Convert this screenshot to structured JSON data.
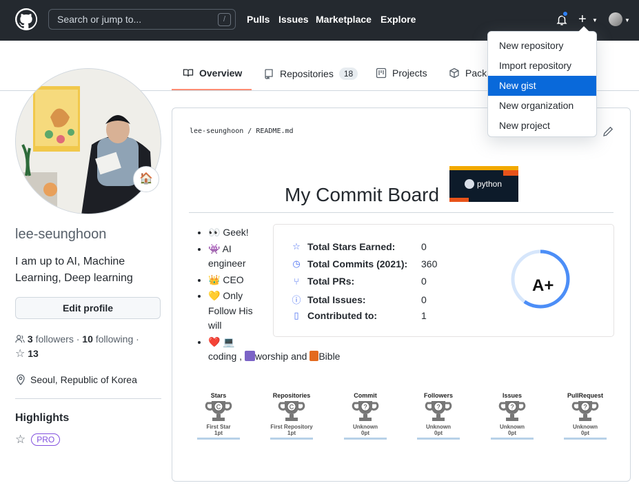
{
  "header": {
    "search_placeholder": "Search or jump to...",
    "search_shortcut": "/",
    "nav": [
      "Pulls",
      "Issues",
      "Marketplace",
      "Explore"
    ]
  },
  "dropdown": {
    "items": [
      "New repository",
      "Import repository",
      "New gist",
      "New organization",
      "New project"
    ],
    "active": "New gist"
  },
  "tabs": {
    "overview": "Overview",
    "repositories": "Repositories",
    "repositories_count": "18",
    "projects": "Projects",
    "packages": "Packa"
  },
  "profile": {
    "username": "lee-seunghoon",
    "bio": "I am up to AI, Machine Learning, Deep learning",
    "edit_button": "Edit profile",
    "followers_count": "3",
    "followers_label": "followers",
    "following_count": "10",
    "following_label": "following",
    "stars_count": "13",
    "location": "Seoul, Republic of Korea",
    "highlights_title": "Highlights",
    "pro_badge": "PRO"
  },
  "readme": {
    "path_owner": "lee-seunghoon",
    "path_file": "README.md",
    "title": "My Commit Board",
    "python_badge": "python",
    "list": [
      {
        "emoji": "👀",
        "text": "Geek!"
      },
      {
        "emoji": "👾",
        "text": "AI engineer"
      },
      {
        "emoji": "👑",
        "text": "CEO"
      },
      {
        "emoji": "💛",
        "text": "Only Follow His will"
      },
      {
        "emoji": "❤️ 💻",
        "text": "coding , ",
        "extra1": "worship and ",
        "extra2": "Bible"
      }
    ],
    "stats": [
      {
        "icon": "star-icon",
        "label": "Total Stars Earned:",
        "value": "0"
      },
      {
        "icon": "history-icon",
        "label": "Total Commits (2021):",
        "value": "360"
      },
      {
        "icon": "pr-icon",
        "label": "Total PRs:",
        "value": "0"
      },
      {
        "icon": "issue-icon",
        "label": "Total Issues:",
        "value": "0"
      },
      {
        "icon": "repo-icon",
        "label": "Contributed to:",
        "value": "1"
      }
    ],
    "grade": "A+",
    "trophies": [
      {
        "title": "Stars",
        "rank": "C",
        "sub": "First Star",
        "pt": "1pt"
      },
      {
        "title": "Repositories",
        "rank": "C",
        "sub": "First Repository",
        "pt": "1pt"
      },
      {
        "title": "Commit",
        "rank": "?",
        "sub": "Unknown",
        "pt": "0pt"
      },
      {
        "title": "Followers",
        "rank": "?",
        "sub": "Unknown",
        "pt": "0pt"
      },
      {
        "title": "Issues",
        "rank": "?",
        "sub": "Unknown",
        "pt": "0pt"
      },
      {
        "title": "PullRequest",
        "rank": "?",
        "sub": "Unknown",
        "pt": "0pt"
      }
    ]
  },
  "colors": {
    "header_bg": "#24292f",
    "accent": "#0969da",
    "tab_underline": "#fd8c73",
    "stats_icon": "#4c71f2",
    "ring": "#4c8ef7"
  }
}
